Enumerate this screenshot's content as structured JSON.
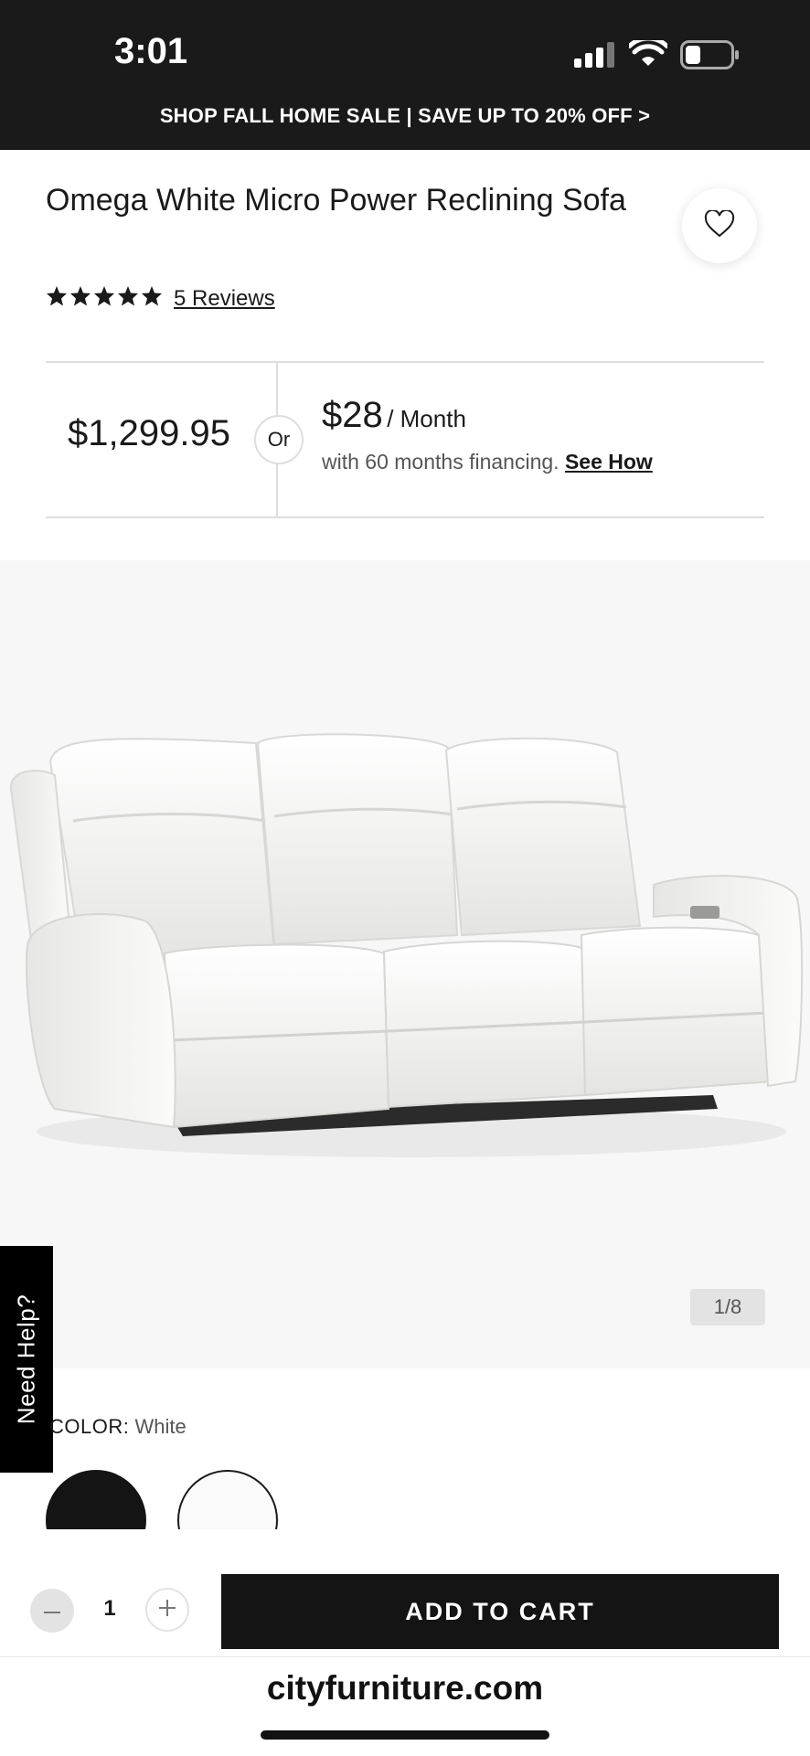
{
  "status_bar": {
    "time": "3:01"
  },
  "promo_banner": {
    "text": "SHOP FALL HOME SALE | SAVE UP TO 20% OFF >"
  },
  "product": {
    "title": "Omega White Micro Power Reclining Sofa",
    "rating": 5,
    "rating_max": 5,
    "reviews_label": "5 Reviews"
  },
  "pricing": {
    "price": "$1,299.95",
    "or_label": "Or",
    "monthly_amount": "$28",
    "monthly_unit": "/ Month",
    "financing_text": "with 60 months financing.",
    "see_how_label": "See How"
  },
  "gallery": {
    "counter": "1/8"
  },
  "help_tab": {
    "label": "Need Help?"
  },
  "color": {
    "label": "COLOR:",
    "selected": "White",
    "swatches": [
      "#141414",
      "#fafafa"
    ]
  },
  "cart": {
    "quantity": "1",
    "add_label": "ADD TO CART"
  },
  "browser": {
    "url": "cityfurniture.com"
  },
  "icons": [
    "heart-icon",
    "star-icon",
    "minus-icon",
    "plus-icon",
    "signal-icon",
    "wifi-icon",
    "battery-icon"
  ]
}
